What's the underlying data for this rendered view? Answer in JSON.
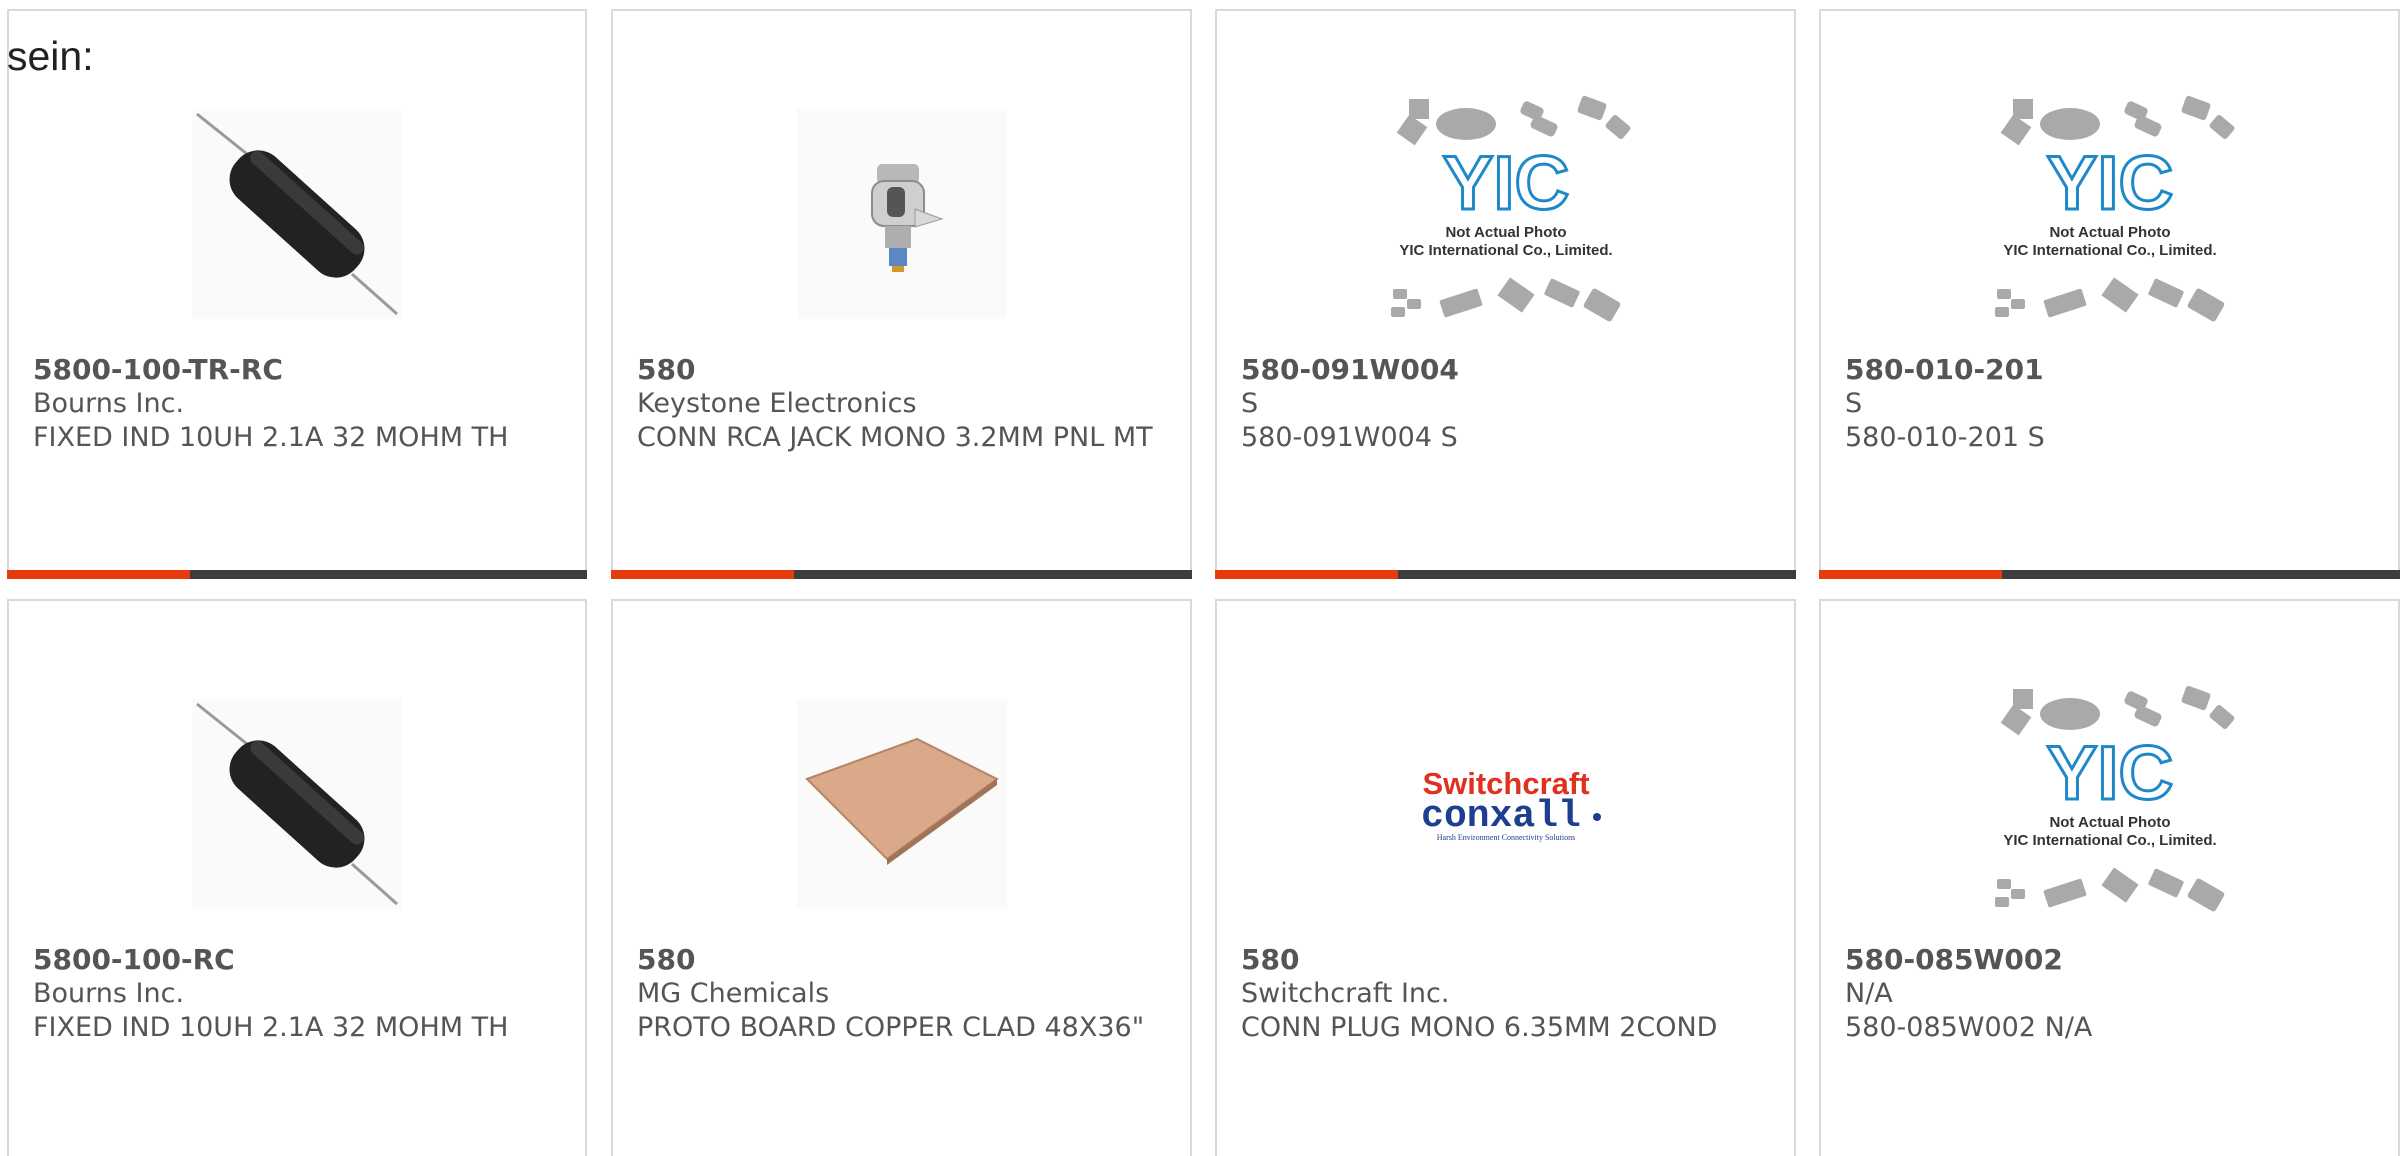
{
  "prefix_text": "sein:",
  "products": [
    {
      "part_number": "5800-100-TR-RC",
      "manufacturer": "Bourns Inc.",
      "description": "FIXED IND 10UH 2.1A 32 MOHM TH",
      "image": "inductor-icon"
    },
    {
      "part_number": "580",
      "manufacturer": "Keystone Electronics",
      "description": "CONN RCA JACK MONO 3.2MM PNL MT",
      "image": "rca-jack-icon"
    },
    {
      "part_number": "580-091W004",
      "manufacturer": "S",
      "description": "580-091W004 S",
      "image": "placeholder-yic-image",
      "image_text": [
        "Not Actual Photo",
        "YIC International Co., Limited."
      ]
    },
    {
      "part_number": "580-010-201",
      "manufacturer": "S",
      "description": "580-010-201 S",
      "image": "placeholder-yic-image",
      "image_text": [
        "Not Actual Photo",
        "YIC International Co., Limited."
      ]
    },
    {
      "part_number": "5800-100-RC",
      "manufacturer": "Bourns Inc.",
      "description": "FIXED IND 10UH 2.1A 32 MOHM TH",
      "image": "inductor-icon"
    },
    {
      "part_number": "580",
      "manufacturer": "MG Chemicals",
      "description": "PROTO BOARD COPPER CLAD 48X36\"",
      "image": "copper-board-icon"
    },
    {
      "part_number": "580",
      "manufacturer": "Switchcraft Inc.",
      "description": "CONN PLUG MONO 6.35MM 2COND",
      "image": "switchcraft-conxall-logo",
      "image_text": [
        "Switchcraft",
        "conxall",
        "Harsh Environment Connectivity Solutions"
      ]
    },
    {
      "part_number": "580-085W002",
      "manufacturer": "N/A",
      "description": "580-085W002 N/A",
      "image": "placeholder-yic-image",
      "image_text": [
        "Not Actual Photo",
        "YIC International Co., Limited."
      ]
    }
  ],
  "colors": {
    "accent_bar": "#e53a0c",
    "bar_dark": "#3d3d3d",
    "card_border": "#d9d9d9",
    "text": "#555555",
    "yic_logo": "#1e88c8",
    "switchcraft_red": "#e0301e",
    "conxall_blue": "#1e3f8f"
  }
}
